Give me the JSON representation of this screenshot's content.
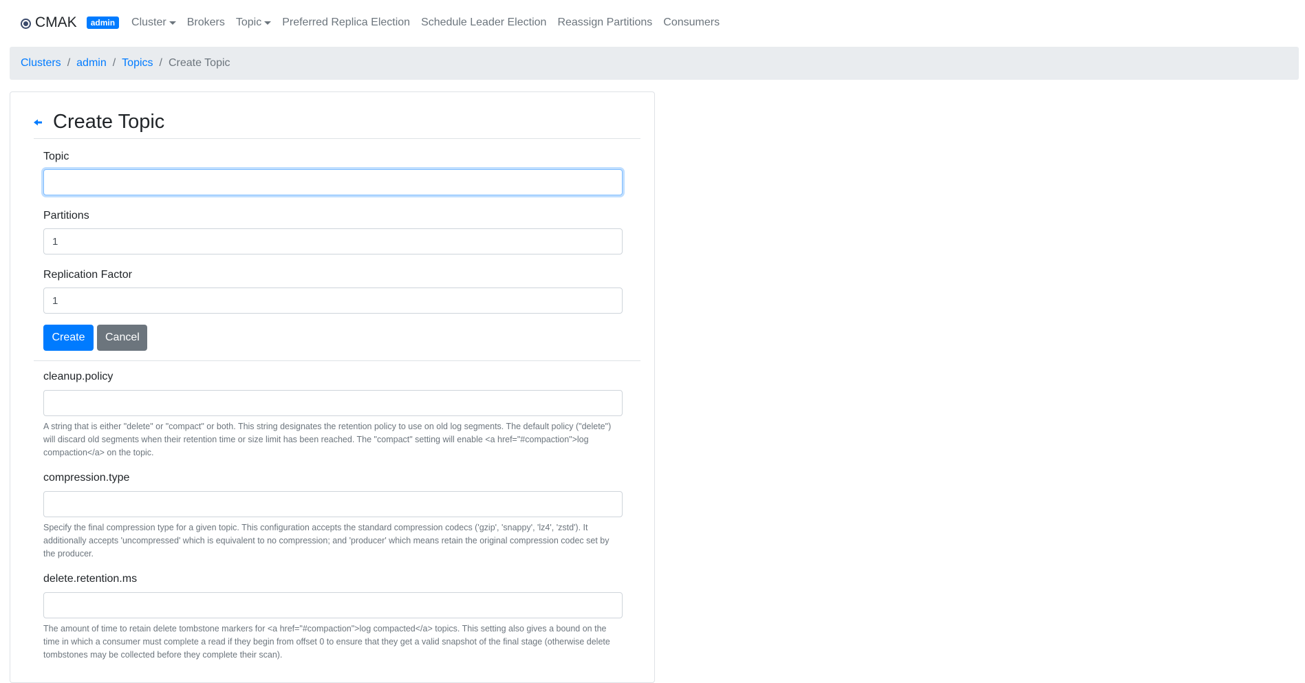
{
  "navbar": {
    "brand": "CMAK",
    "badge": "admin",
    "links": [
      {
        "label": "Cluster",
        "dropdown": true
      },
      {
        "label": "Brokers",
        "dropdown": false
      },
      {
        "label": "Topic",
        "dropdown": true
      },
      {
        "label": "Preferred Replica Election",
        "dropdown": false
      },
      {
        "label": "Schedule Leader Election",
        "dropdown": false
      },
      {
        "label": "Reassign Partitions",
        "dropdown": false
      },
      {
        "label": "Consumers",
        "dropdown": false
      }
    ]
  },
  "breadcrumb": {
    "items": [
      "Clusters",
      "admin",
      "Topics"
    ],
    "active": "Create Topic"
  },
  "page": {
    "title": "Create Topic"
  },
  "form": {
    "topic": {
      "label": "Topic",
      "value": ""
    },
    "partitions": {
      "label": "Partitions",
      "value": "1"
    },
    "replication": {
      "label": "Replication Factor",
      "value": "1"
    },
    "create_label": "Create",
    "cancel_label": "Cancel"
  },
  "configs": [
    {
      "name": "cleanup.policy",
      "value": "",
      "help": "A string that is either \"delete\" or \"compact\" or both. This string designates the retention policy to use on old log segments. The default policy (\"delete\") will discard old segments when their retention time or size limit has been reached. The \"compact\" setting will enable <a href=\"#compaction\">log compaction</a> on the topic."
    },
    {
      "name": "compression.type",
      "value": "",
      "help": "Specify the final compression type for a given topic. This configuration accepts the standard compression codecs ('gzip', 'snappy', 'lz4', 'zstd'). It additionally accepts 'uncompressed' which is equivalent to no compression; and 'producer' which means retain the original compression codec set by the producer."
    },
    {
      "name": "delete.retention.ms",
      "value": "",
      "help": "The amount of time to retain delete tombstone markers for <a href=\"#compaction\">log compacted</a> topics. This setting also gives a bound on the time in which a consumer must complete a read if they begin from offset 0 to ensure that they get a valid snapshot of the final stage (otherwise delete tombstones may be collected before they complete their scan)."
    }
  ],
  "colors": {
    "primary": "#007bff",
    "secondary": "#6c757d",
    "breadcrumb_bg": "#e9ecef"
  }
}
